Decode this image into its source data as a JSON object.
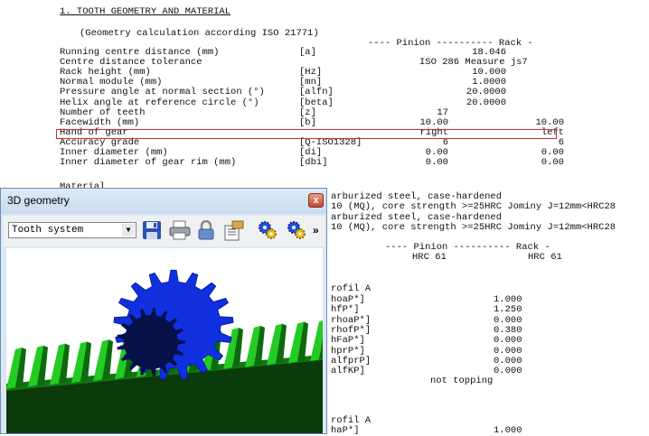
{
  "report": {
    "section_title": "1. TOOTH GEOMETRY AND MATERIAL",
    "subtitle": "(Geometry calculation according ISO 21771)",
    "col_header": "---- Pinion ---------- Rack -",
    "rows": [
      {
        "label": "Running centre distance (mm)",
        "sym": "[a]",
        "v1": "18.046",
        "v2": ""
      },
      {
        "label": "Centre distance tolerance",
        "sym": "",
        "v1": "ISO 286 Measure js7",
        "v2": ""
      },
      {
        "label": "Rack height (mm)",
        "sym": "[Hz]",
        "v1": "10.000",
        "v2": ""
      },
      {
        "label": "Normal module (mm)",
        "sym": "[mn]",
        "v1": "1.0000",
        "v2": ""
      },
      {
        "label": "Pressure angle at normal section (°)",
        "sym": "[alfn]",
        "v1": "20.0000",
        "v2": ""
      },
      {
        "label": "Helix angle at reference circle (°)",
        "sym": "[beta]",
        "v1": "20.0000",
        "v2": ""
      },
      {
        "label": "Number of teeth",
        "sym": "[z]",
        "v1": "17",
        "v2": ""
      },
      {
        "label": "Facewidth (mm)",
        "sym": "[b]",
        "v1": "10.00",
        "v2": "10.00"
      },
      {
        "label": "Hand of gear",
        "sym": "",
        "v1": "right",
        "v2": "left"
      },
      {
        "label": "Accuracy grade",
        "sym": "[Q-ISO1328]",
        "v1": "6",
        "v2": "6"
      },
      {
        "label": "Inner diameter (mm)",
        "sym": "[di]",
        "v1": "0.00",
        "v2": "0.00"
      },
      {
        "label": "Inner diameter of gear rim (mm)",
        "sym": "[dbi]",
        "v1": "0.00",
        "v2": "0.00"
      }
    ],
    "material_label": "Material",
    "mat_line1": "arburized steel, case-hardened",
    "mat_line2": "10 (MQ), core strength >=25HRC Jominy J=12mm<HRC28",
    "mat_line3": "arburized steel, case-hardened",
    "mat_line4": "10 (MQ), core strength >=25HRC Jominy J=12mm<HRC28",
    "col_header2": "---- Pinion ---------- Rack -",
    "hrc_p": "HRC 61",
    "hrc_r": "HRC 61",
    "profile_a": "rofil A",
    "params": [
      {
        "sym": "hoaP*]",
        "val": "1.000"
      },
      {
        "sym": "hfP*]",
        "val": "1.250"
      },
      {
        "sym": "rhoaP*]",
        "val": "0.000"
      },
      {
        "sym": "rhofP*]",
        "val": "0.380"
      },
      {
        "sym": "hFaP*]",
        "val": "0.000"
      },
      {
        "sym": "hprP*]",
        "val": "0.000"
      },
      {
        "sym": "alfprP]",
        "val": "0.000"
      },
      {
        "sym": "alfKP]",
        "val": "0.000"
      }
    ],
    "not_topping": "not topping",
    "profile_a2": "rofil A",
    "bottom_sym": "haP*]",
    "bottom_val": "1.000"
  },
  "window": {
    "title": "3D geometry",
    "close": "x",
    "select_value": "Tooth system",
    "more": "»",
    "icons": [
      "save-icon",
      "print-icon",
      "lock-icon",
      "export-icon",
      "gear-settings-icon",
      "gear-settings-2-icon"
    ]
  },
  "colors": {
    "pinion": "#1030e0",
    "rack": "#1fc01f",
    "highlight": "#c83232"
  }
}
